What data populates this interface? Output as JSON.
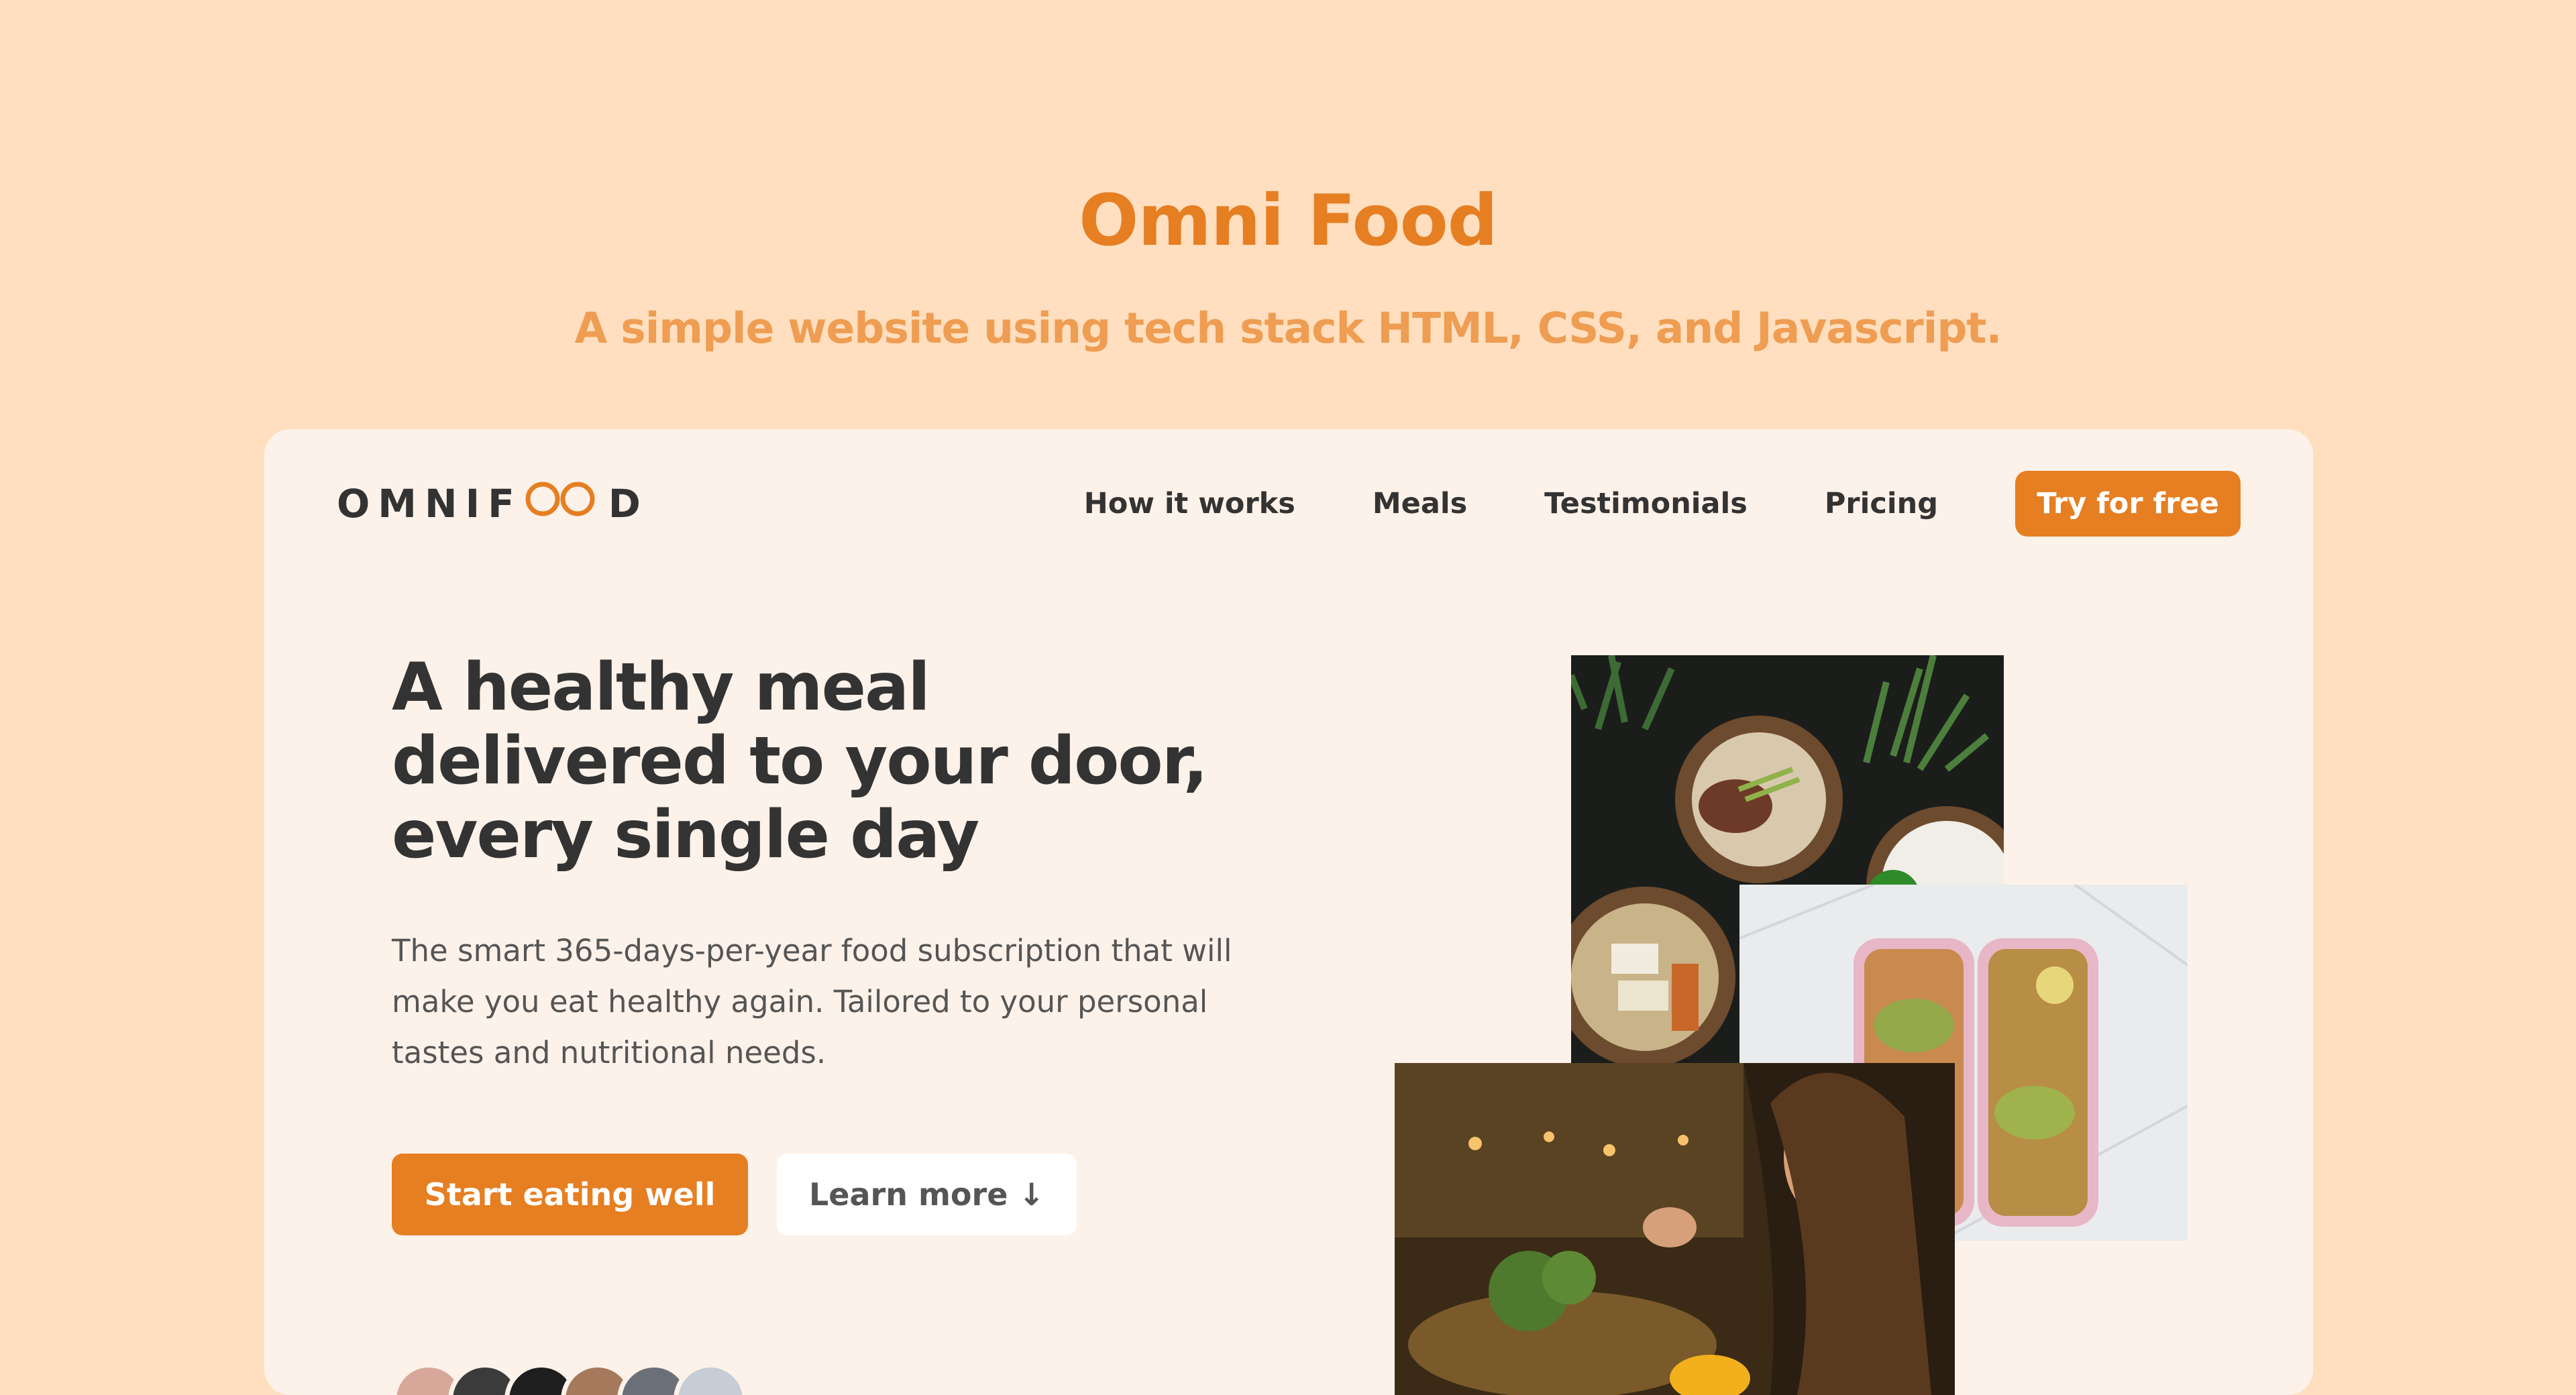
{
  "page": {
    "title": "Omni Food",
    "subtitle": "A simple website using tech stack HTML, CSS, and Javascript."
  },
  "header": {
    "logo_left": "OMNIF",
    "logo_right": "D",
    "logo_icon": "infinity-icon",
    "nav": [
      "How it works",
      "Meals",
      "Testimonials",
      "Pricing"
    ],
    "cta": "Try for free"
  },
  "hero": {
    "title": "A healthy meal delivered to your door, every single day",
    "description": "The smart 365-days-per-year food subscription that will make you eat healthy again. Tailored to your personal tastes and nutritional needs.",
    "primary_button": "Start eating well",
    "secondary_button": "Learn more ↓"
  },
  "colors": {
    "accent": "#e67e22",
    "background": "#ffdfbf",
    "card": "#fdf2e9"
  }
}
